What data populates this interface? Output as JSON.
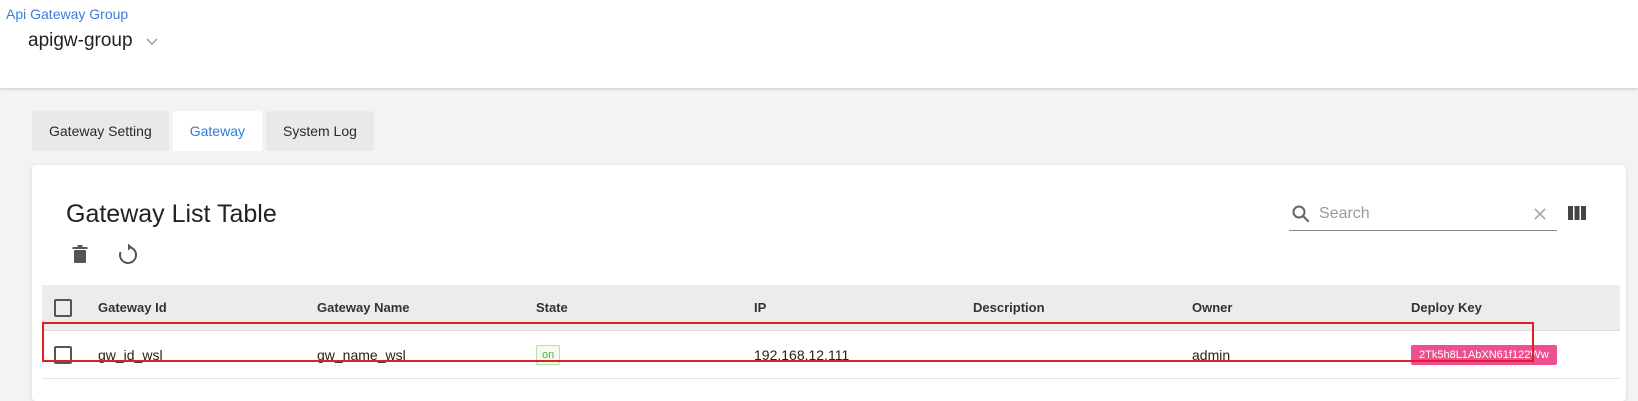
{
  "header": {
    "breadcrumb": "Api Gateway Group",
    "group_name": "apigw-group"
  },
  "tabs": [
    {
      "label": "Gateway Setting",
      "active": false
    },
    {
      "label": "Gateway",
      "active": true
    },
    {
      "label": "System Log",
      "active": false
    }
  ],
  "card": {
    "title": "Gateway List Table",
    "search": {
      "placeholder": "Search",
      "value": ""
    }
  },
  "table": {
    "columns": [
      "Gateway Id",
      "Gateway Name",
      "State",
      "IP",
      "Description",
      "Owner",
      "Deploy Key"
    ],
    "rows": [
      {
        "gateway_id": "gw_id_wsl",
        "gateway_name": "gw_name_wsl",
        "state": "on",
        "ip": "192.168.12.111",
        "description": "",
        "owner": "admin",
        "deploy_key": "2Tk5h8L1AbXN61f122Ww"
      }
    ]
  },
  "icons": {
    "dropdown": "chevron-down-icon",
    "search": "search-icon",
    "clear": "close-icon",
    "columns": "view-column-icon",
    "delete": "trash-icon",
    "refresh": "refresh-icon"
  },
  "colors": {
    "accent": "#2f7bd8",
    "state_on": "#4caf50",
    "deploy_key_badge": "#ee4f8f",
    "highlight_border": "#e01f25"
  }
}
